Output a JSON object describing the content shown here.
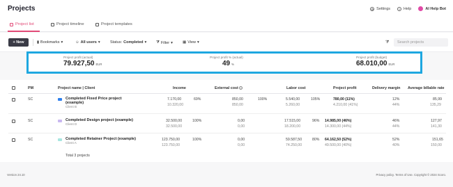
{
  "header": {
    "title": "Projects",
    "settings_label": "Settings",
    "help_label": "Help",
    "ai_label": "AI Help Bot"
  },
  "tabs": [
    {
      "label": "Project list"
    },
    {
      "label": "Project timeline"
    },
    {
      "label": "Project templates"
    }
  ],
  "toolbar": {
    "new_label": "+ New",
    "bookmarks_label": "Bookmarks",
    "users_label": "All users",
    "status_prefix": "Status:",
    "status_value": "Completed",
    "filter_label": "Filter",
    "view_label": "View",
    "search_placeholder": "Search projects"
  },
  "summary": {
    "profit_label": "Project profit (actual)",
    "profit_value": "79.927,50",
    "profit_unit": "EUR",
    "pct_label": "Project profit % (actual)",
    "pct_value": "49",
    "pct_unit": "%",
    "budget_label": "Project profit (budget)",
    "budget_value": "68.010,00",
    "budget_unit": "EUR"
  },
  "table": {
    "headers": {
      "pm": "PM",
      "name": "Project name | Client",
      "income": "Income",
      "external": "External cost",
      "labor": "Labor cost",
      "profit": "Project profit",
      "margin": "Delivery margin",
      "rate": "Average billable rate"
    },
    "rows": [
      {
        "pm": "SC",
        "name": "Completed Fixed Price project (example)",
        "client": "Client B",
        "dot_color": "#2f80ed",
        "income": "7.170,00",
        "income_sub": "10.320,00",
        "income_pct": "69%",
        "ext": "850,00",
        "ext_sub": "850,00",
        "ext_pct": "100%",
        "labor": "5.540,00",
        "labor_sub": "5.260,00",
        "labor_pct": "105%",
        "profit": "780,00 (11%)",
        "profit_sub": "4.210,00 (41%)",
        "margin": "12%",
        "margin_sub": "44%",
        "rate": "85,99",
        "rate_sub": "135,29"
      },
      {
        "pm": "SC",
        "name": "Completed Design project (example)",
        "client": "Client D",
        "dot_color": "#c9b8f0",
        "income": "32.500,00",
        "income_sub": "32.500,00",
        "income_pct": "100%",
        "ext": "0,00",
        "ext_sub": "0,00",
        "ext_pct": "",
        "labor": "17.515,00",
        "labor_sub": "18.200,00",
        "labor_pct": "96%",
        "profit": "14.985,00 (46%)",
        "profit_sub": "14.300,00 (44%)",
        "margin": "46%",
        "margin_sub": "44%",
        "rate": "127,97",
        "rate_sub": "141,30"
      },
      {
        "pm": "SC",
        "name": "Completed Retainer Project (example)",
        "client": "Client A",
        "dot_color": "#a8e6e0",
        "income": "123.750,00",
        "income_sub": "123.750,00",
        "income_pct": "100%",
        "ext": "0,00",
        "ext_sub": "0,00",
        "ext_pct": "",
        "labor": "59.587,50",
        "labor_sub": "74.250,00",
        "labor_pct": "80%",
        "profit": "64.162,50 (52%)",
        "profit_sub": "49.500,00 (40%)",
        "margin": "52%",
        "margin_sub": "40%",
        "rate": "151,65",
        "rate_sub": "150,00"
      }
    ],
    "total_label": "Total 3 projects"
  },
  "footer": {
    "version": "Version 24.10",
    "links": "Privacy policy. Terms of Use. Copyright © 2024 Scoro."
  },
  "colors": {
    "accent": "#e24a77",
    "highlight_border": "#1ea7e0",
    "new_button": "#3a3b46"
  }
}
